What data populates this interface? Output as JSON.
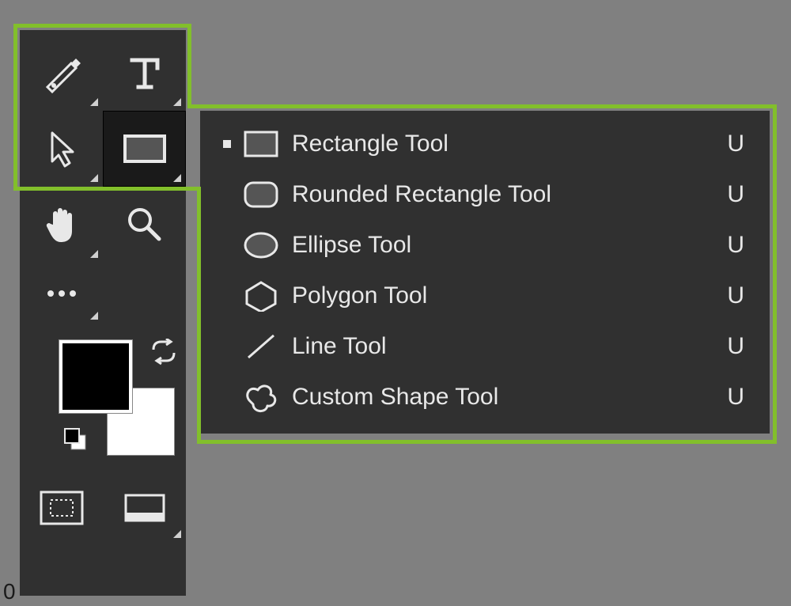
{
  "toolbar": {
    "tools": [
      {
        "name": "pen-tool",
        "icon": "pen"
      },
      {
        "name": "type-tool",
        "icon": "type"
      },
      {
        "name": "path-selection-tool",
        "icon": "arrow"
      },
      {
        "name": "rectangle-tool",
        "icon": "rect",
        "active": true
      },
      {
        "name": "hand-tool",
        "icon": "hand"
      },
      {
        "name": "zoom-tool",
        "icon": "zoom"
      },
      {
        "name": "more-tools",
        "icon": "dots"
      }
    ],
    "swatch": {
      "fg": "#000000",
      "bg": "#ffffff"
    },
    "bottom_tools": [
      {
        "name": "quick-mask-tool",
        "icon": "quickmask"
      },
      {
        "name": "screen-mode-tool",
        "icon": "screenmode"
      }
    ]
  },
  "flyout": {
    "items": [
      {
        "icon": "rect",
        "label": "Rectangle Tool",
        "shortcut": "U",
        "selected": true
      },
      {
        "icon": "rrect",
        "label": "Rounded Rectangle Tool",
        "shortcut": "U",
        "selected": false
      },
      {
        "icon": "ellipse",
        "label": "Ellipse Tool",
        "shortcut": "U",
        "selected": false
      },
      {
        "icon": "polygon",
        "label": "Polygon Tool",
        "shortcut": "U",
        "selected": false
      },
      {
        "icon": "line",
        "label": "Line Tool",
        "shortcut": "U",
        "selected": false
      },
      {
        "icon": "blob",
        "label": "Custom Shape Tool",
        "shortcut": "U",
        "selected": false
      }
    ]
  },
  "highlight_color": "#82bf2b",
  "footer_zero": "0"
}
